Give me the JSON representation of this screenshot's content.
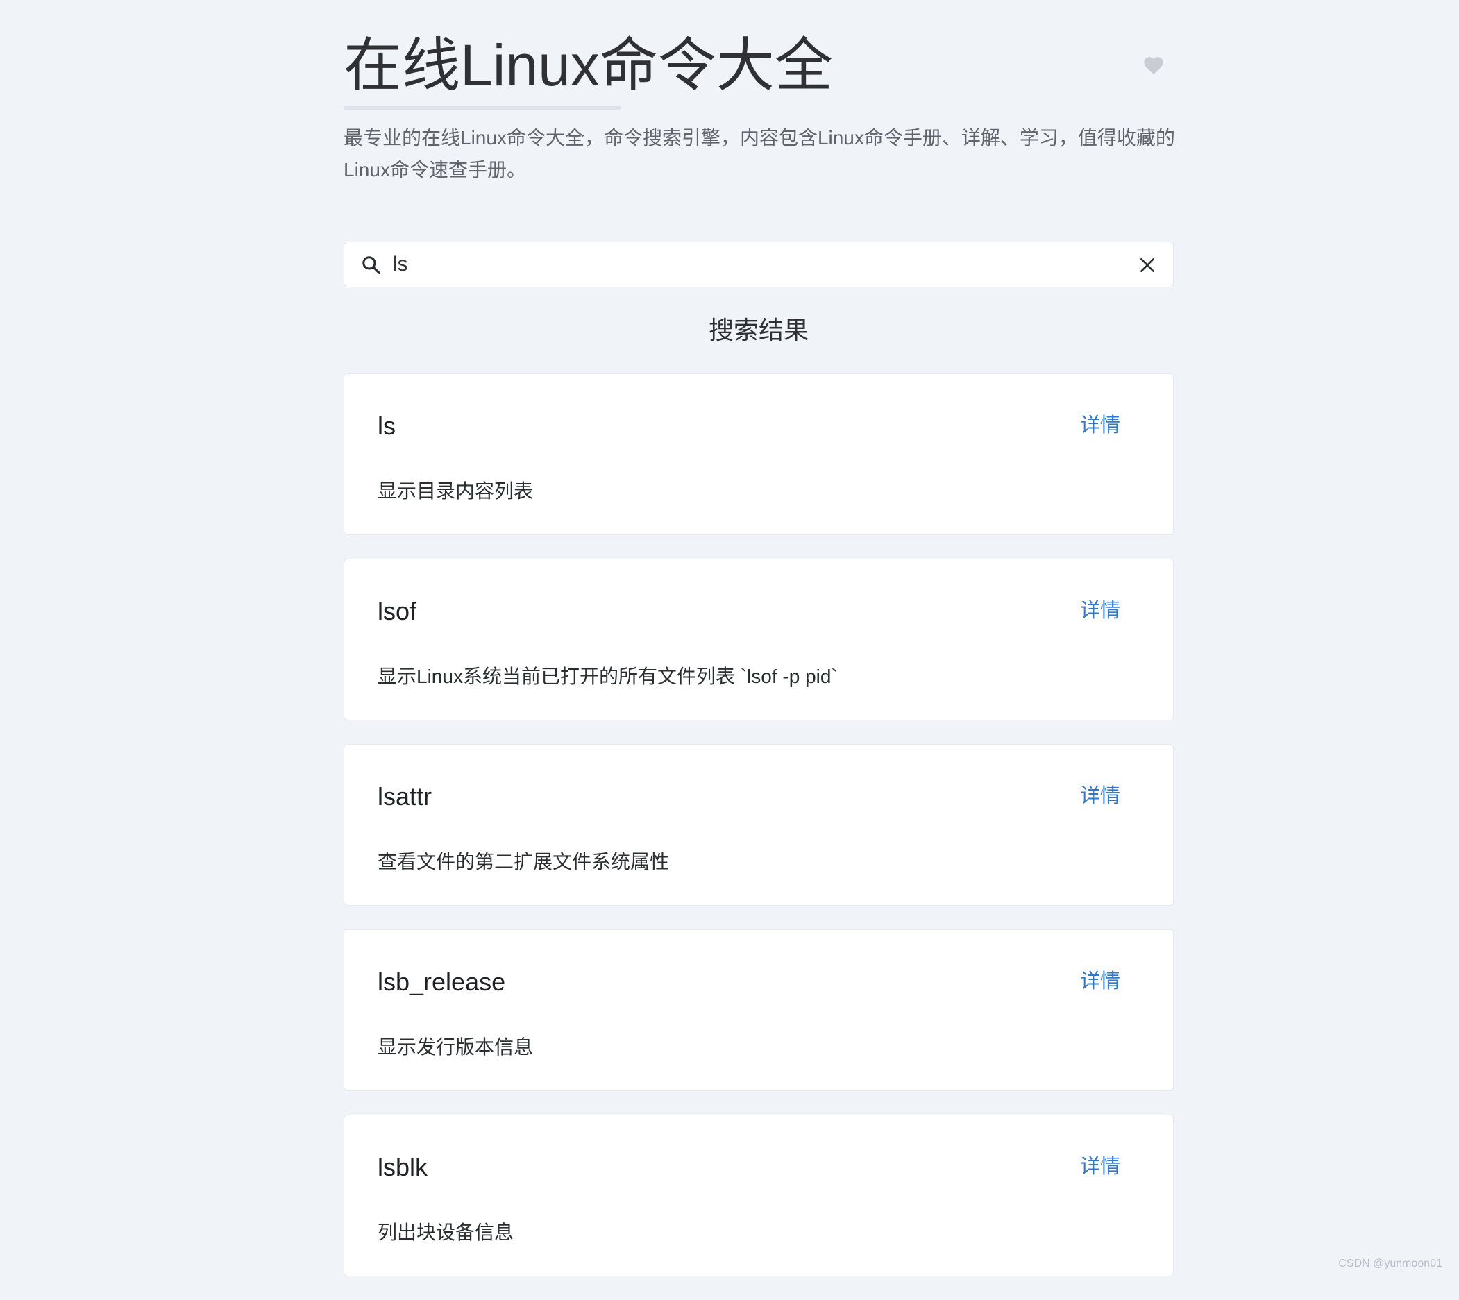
{
  "header": {
    "title": "在线Linux命令大全",
    "subtitle": "最专业的在线Linux命令大全，命令搜索引擎，内容包含Linux命令手册、详解、学习，值得收藏的Linux命令速查手册。"
  },
  "search": {
    "value": "ls",
    "icon": "search-icon",
    "clear_icon": "close-icon"
  },
  "results": {
    "heading": "搜索结果",
    "detail_label": "详情",
    "items": [
      {
        "name": "ls",
        "description": "显示目录内容列表",
        "link": "详情"
      },
      {
        "name": "lsof",
        "description": "显示Linux系统当前已打开的所有文件列表 `lsof -p pid`",
        "link": "详情"
      },
      {
        "name": "lsattr",
        "description": "查看文件的第二扩展文件系统属性",
        "link": "详情"
      },
      {
        "name": "lsb_release",
        "description": "显示发行版本信息",
        "link": "详情"
      },
      {
        "name": "lsblk",
        "description": "列出块设备信息",
        "link": "详情"
      }
    ]
  },
  "watermark": "CSDN @yunmoon01",
  "colors": {
    "background": "#f0f3f8",
    "link": "#2e7ad1",
    "card": "#ffffff",
    "heart": "#c9ccd2"
  }
}
